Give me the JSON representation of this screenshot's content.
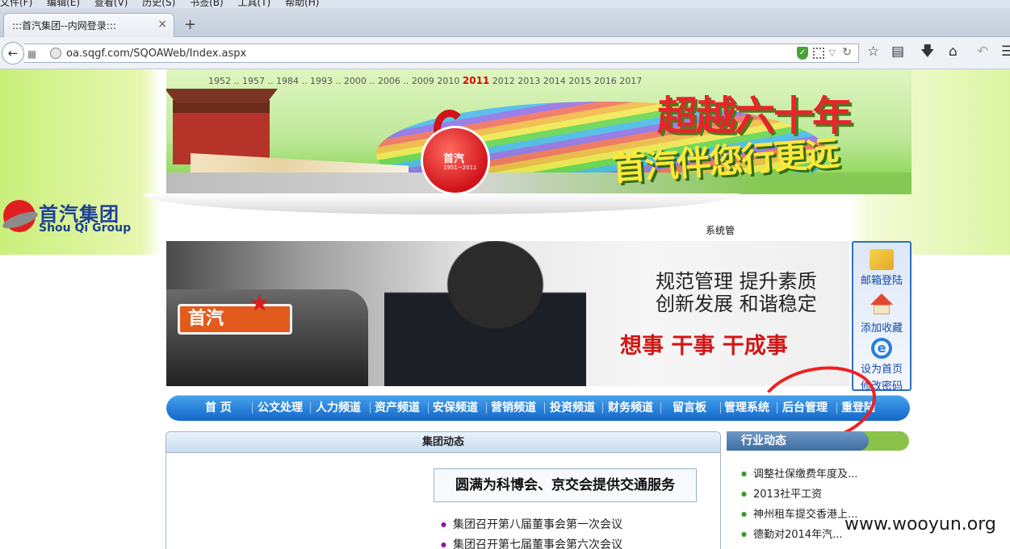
{
  "browser": {
    "menu": [
      "文件(F)",
      "编辑(E)",
      "查看(V)",
      "历史(S)",
      "书签(B)",
      "工具(T)",
      "帮助(H)"
    ],
    "tab_title": ":::首汽集团--内网登录:::",
    "tab_close": "×",
    "new_tab": "+",
    "url": "oa.sqgf.com/SQOAWeb/Index.aspx",
    "icons": [
      "back-icon",
      "grid-icon",
      "globe-icon",
      "shield-icon",
      "qr-icon",
      "dropdown-icon",
      "reload-icon",
      "star-icon",
      "reading-list-icon",
      "download-icon",
      "home-icon",
      "undo-icon",
      "menu-icon"
    ]
  },
  "banner": {
    "years_prefix": "1952 .. 1957 .. 1984 .. 1993 .. 2000 .. 2006 .. 2009 2010",
    "year_highlight": "2011",
    "years_suffix": "2012 2013 2014 2015 2016 2017",
    "emblem_name": "首汽",
    "emblem_years": "1951~2011",
    "slogan1": "超越六十年",
    "slogan2": "首汽伴您行更远"
  },
  "logo": {
    "cn": "首汽集团",
    "en": "Shou Qi Group"
  },
  "header": {
    "system_text": "系统管"
  },
  "hero": {
    "taxi_sign": "首汽",
    "slogan_line1": "规范管理  提升素质",
    "slogan_line2": "创新发展  和谐稳定",
    "slogan_line3": "想事  干事  干成事"
  },
  "side_links": {
    "mail": "邮箱登陆",
    "favorite": "添加收藏",
    "homepage": "设为首页",
    "password": "修改密码"
  },
  "nav": {
    "items": [
      "首  页",
      "公文处理",
      "人力频道",
      "资产频道",
      "安保频道",
      "营销频道",
      "投资频道",
      "财务频道",
      "留言板",
      "管理系统",
      "后台管理",
      "重登陆"
    ]
  },
  "group_news": {
    "title": "集团动态",
    "headline": "圆满为科博会、京交会提供交通服务",
    "items": [
      "集团召开第八届董事会第一次会议",
      "集团召开第七届董事会第六次会议"
    ]
  },
  "industry_news": {
    "title": "行业动态",
    "items": [
      "调整社保缴费年度及...",
      "2013社平工资",
      "神州租车提交香港上...",
      "德勤对2014年汽..."
    ]
  },
  "watermark": "www.wooyun.org",
  "colors": {
    "nav_blue": "#1467c9",
    "annotation_red": "#ef2020",
    "year_red": "#dd0000",
    "logo_blue": "#1c3f95"
  }
}
